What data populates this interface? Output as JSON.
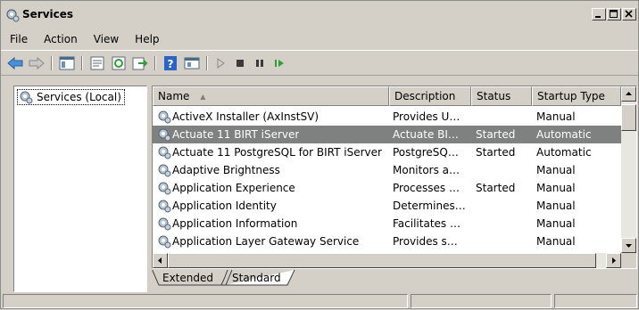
{
  "window": {
    "title": "Services"
  },
  "menubar": {
    "items": [
      "File",
      "Action",
      "View",
      "Help"
    ]
  },
  "toolbar": {
    "buttons": [
      "back-icon",
      "forward-icon",
      "show-hide-tree-icon",
      "properties-icon",
      "refresh-icon",
      "export-list-icon",
      "help-icon",
      "console-icon",
      "play-icon",
      "stop-icon",
      "pause-icon",
      "resume-icon"
    ]
  },
  "tree": {
    "root_label": "Services (Local)"
  },
  "table": {
    "columns": [
      "Name",
      "Description",
      "Status",
      "Startup Type"
    ],
    "sort_indicator": "▲",
    "rows": [
      {
        "name": "ActiveX Installer (AxInstSV)",
        "description": "Provides U…",
        "status": "",
        "startup": "Manual",
        "selected": false
      },
      {
        "name": "Actuate 11 BIRT iServer",
        "description": "Actuate BI…",
        "status": "Started",
        "startup": "Automatic",
        "selected": true
      },
      {
        "name": "Actuate 11 PostgreSQL for BIRT iServer",
        "description": "PostgreSQ…",
        "status": "Started",
        "startup": "Automatic",
        "selected": false
      },
      {
        "name": "Adaptive Brightness",
        "description": "Monitors a…",
        "status": "",
        "startup": "Manual",
        "selected": false
      },
      {
        "name": "Application Experience",
        "description": "Processes …",
        "status": "Started",
        "startup": "Manual",
        "selected": false
      },
      {
        "name": "Application Identity",
        "description": "Determines…",
        "status": "",
        "startup": "Manual",
        "selected": false
      },
      {
        "name": "Application Information",
        "description": "Facilitates …",
        "status": "",
        "startup": "Manual",
        "selected": false
      },
      {
        "name": "Application Layer Gateway Service",
        "description": "Provides s…",
        "status": "",
        "startup": "Manual",
        "selected": false
      }
    ]
  },
  "tabs": {
    "extended": "Extended",
    "standard": "Standard",
    "active": "Standard"
  },
  "colors": {
    "selection": "#7f8080",
    "chrome": "#d4d0c8"
  }
}
